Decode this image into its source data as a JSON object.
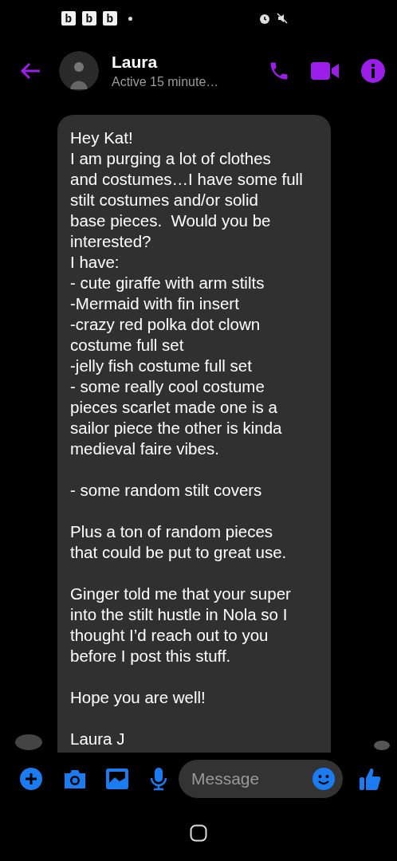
{
  "status_bar": {
    "notification_icons": [
      "b",
      "b",
      "b"
    ]
  },
  "header": {
    "name": "Laura",
    "status": "Active 15 minute…"
  },
  "message": {
    "paragraphs": [
      [
        "Hey Kat!",
        "I am purging a lot of clothes",
        "and costumes…I have some full",
        "stilt costumes and/or solid",
        "base pieces.  Would you be",
        "interested?",
        "I have:",
        "- cute giraffe with arm stilts",
        "-Mermaid with fin insert",
        "-crazy red polka dot clown",
        "costume full set",
        "-jelly fish costume full set",
        "- some really cool costume",
        "pieces scarlet made one is a",
        "sailor piece the other is kinda",
        "medieval faire vibes."
      ],
      [
        "- some random stilt covers"
      ],
      [
        "Plus a ton of random pieces",
        "that could be put to great use."
      ],
      [
        "Ginger told me that your super",
        "into the stilt hustle in Nola so I",
        "thought I’d reach out to you",
        "before I post this stuff."
      ],
      [
        "Hope you are well!"
      ],
      [
        "Laura J"
      ]
    ]
  },
  "composer": {
    "placeholder": "Message"
  }
}
